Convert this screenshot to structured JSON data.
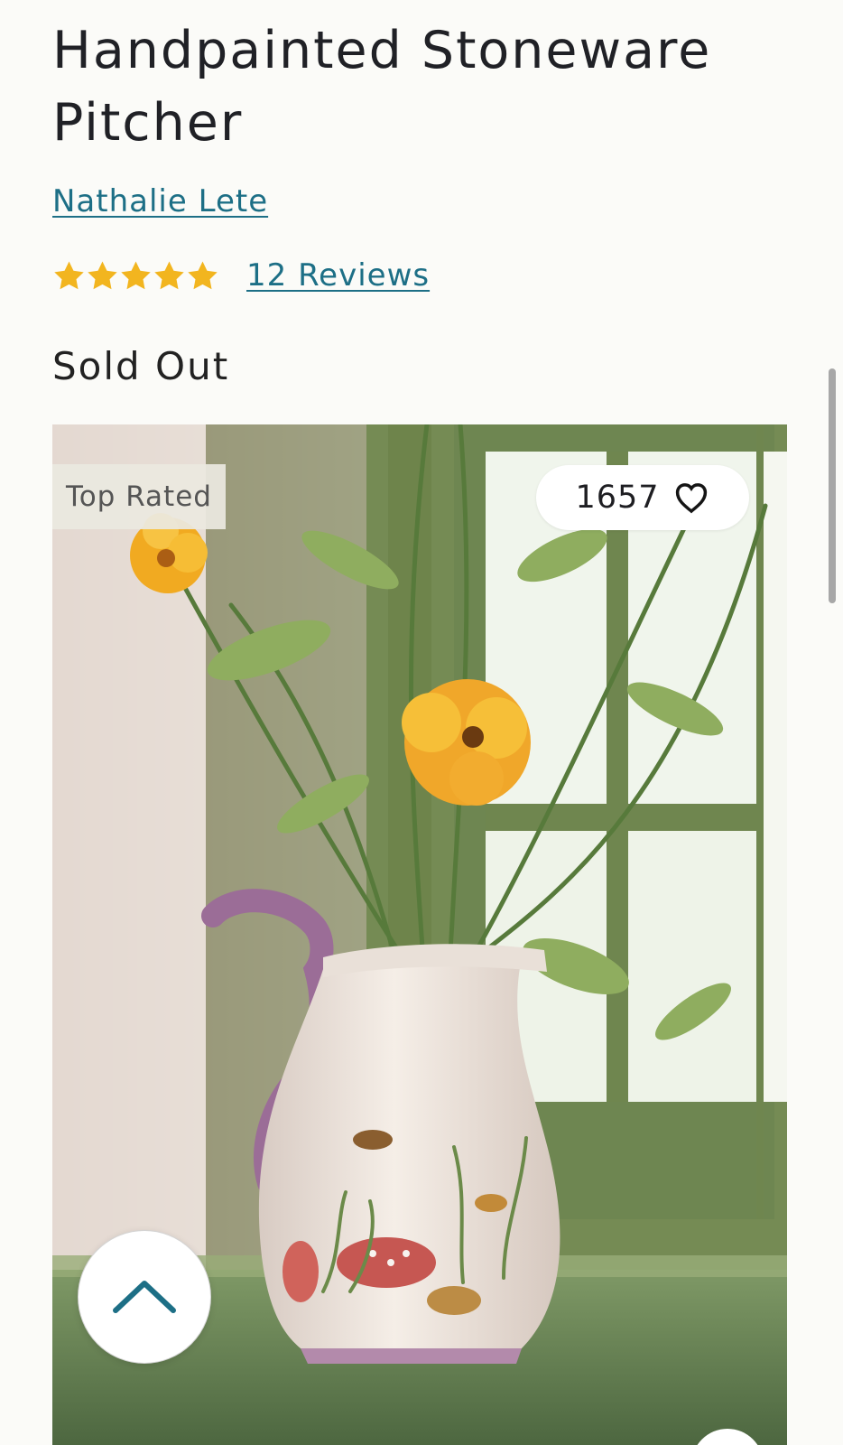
{
  "product": {
    "title": "Handpainted Stoneware Pitcher",
    "designer": "Nathalie Lete",
    "rating": {
      "stars": 5,
      "max_stars": 5,
      "reviews_label": "12 Reviews",
      "star_color": "#f2b51f"
    },
    "availability": "Sold Out"
  },
  "image": {
    "badge": "Top Rated",
    "wishlist_count": "1657",
    "heart_icon": "heart-outline-icon"
  },
  "controls": {
    "scroll_top_icon": "chevron-up-icon",
    "accent_color": "#1d6f86"
  }
}
